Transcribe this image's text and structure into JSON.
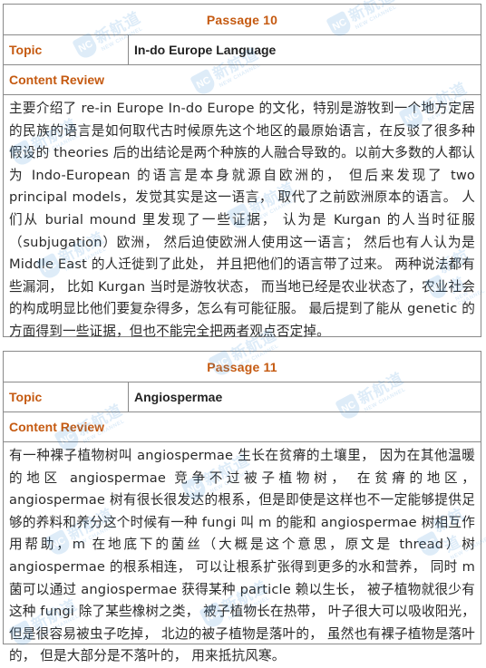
{
  "passages": [
    {
      "title": "Passage 10",
      "topic_label": "Topic",
      "topic": "In-do Europe Language",
      "review_label": "Content Review",
      "content": "主要介绍了 re-in Europe In-do Europe 的文化，特别是游牧到一个地方定居的民族的语言是如何取代古时候原先这个地区的最原始语言，在反驳了很多种假设的 theories 后的出结论是两个种族的人融合导致的。以前大多数的人都认为 Indo-European 的语言是本身就源自欧洲的， 但后来发现了 two principal models，发觉其实是这一语言， 取代了之前欧洲原本的语言。 人们从 burial mound 里发现了一些证据， 认为是 Kurgan 的人当时征服（subjugation）欧洲， 然后迫使欧洲人使用这一语言； 然后也有人认为是 Middle East 的人迁徙到了此处， 并且把他们的语言带了过来。 两种说法都有些漏洞， 比如 Kurgan 当时是游牧状态， 而当地已经是农业状态了，农业社会的构成明显比他们要复杂得多，怎么有可能征服。 最后提到了能从 genetic 的方面得到一些证据，但也不能完全把两者观点否定掉。"
    },
    {
      "title": "Passage 11",
      "topic_label": "Topic",
      "topic": "Angiospermae",
      "review_label": "Content Review",
      "content": "有一种裸子植物树叫 angiospermae 生长在贫瘠的土壤里， 因为在其他温暖的地区 angiospermae 竞争不过被子植物树， 在贫瘠的地区， angiospermae 树有很长很发达的根系，但是即使是这样也不一定能够提供足够的养料和养分这个时候有一种 fungi 叫 m 的能和 angiospermae 树相互作用帮助，m 在地底下的菌丝（大概是这个意思，原文是 thread）树 angiospermae 的根系相连， 可以让根系扩张得到更多的水和营养， 同时 m 菌可以通过 angiospermae 获得某种 particle 赖以生长， 被子植物就很少有这种 fungi 除了某些橡树之类， 被子植物长在热带， 叶子很大可以吸收阳光， 但是很容易被虫子吃掉， 北边的被子植物是落叶的， 虽然也有裸子植物是落叶的， 但是大部分是不落叶的， 用来抵抗风寒。"
    }
  ],
  "watermark": {
    "logo_letters": "NC",
    "chinese": "新航道",
    "english": "NEW CHANNEL"
  },
  "colors": {
    "heading_orange": "#c55a11",
    "border_gray": "#8a8a8a",
    "body_text": "#2a2a2a",
    "watermark_blue": "#3a8fd8"
  }
}
